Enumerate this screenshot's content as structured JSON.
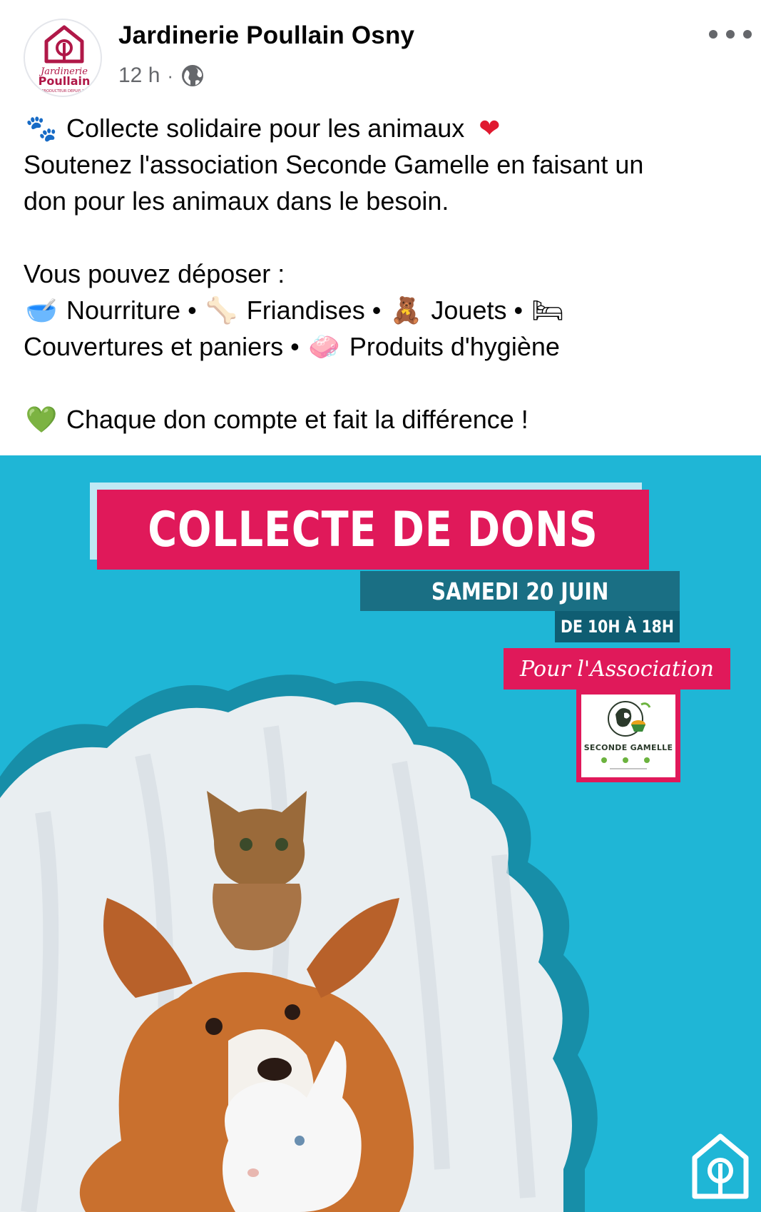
{
  "post": {
    "page_name": "Jardinerie Poullain Osny",
    "time": "12 h",
    "separator": "·",
    "avatar_text_top": "Jardinerie",
    "avatar_text_bottom": "Poullain",
    "avatar_text_tagline": "PRODUCTEUR DEPUIS 19"
  },
  "text": {
    "line1": "Collecte solidaire pour les animaux",
    "line2": "Soutenez l'association Seconde Gamelle en faisant un",
    "line3": "don pour les animaux dans le besoin.",
    "line4": "Vous pouvez déposer :",
    "item_food": "Nourriture •",
    "item_treats": "Friandises •",
    "item_toys": "Jouets •",
    "item_blankets": "Couvertures et paniers •",
    "item_hygiene": "Produits d'hygiène",
    "closing": "Chaque don compte et fait la différence !"
  },
  "icons": {
    "paws": "🐾",
    "heart_red": "❤",
    "bowl": "🥣",
    "bone": "🦴",
    "teddy": "🧸",
    "bed": "🛏",
    "soap": "🧼",
    "heart_green": "💚"
  },
  "poster": {
    "title": "COLLECTE DE DONS",
    "date": "SAMEDI 20 JUIN",
    "hours": "DE 10H À 18H",
    "association_label": "Pour l'Association",
    "association_name": "SECONDE GAMELLE",
    "colors": {
      "background": "#1fb6d6",
      "pink": "#e0195a",
      "teal_dark": "#1a6f84",
      "teal_darker": "#0f5d72"
    }
  }
}
